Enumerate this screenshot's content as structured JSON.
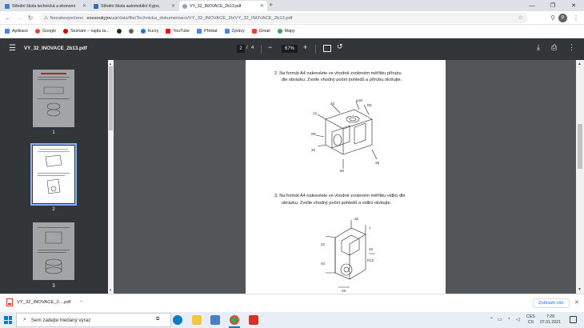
{
  "tabs": [
    {
      "title": "Střední škola technická a ekonomi",
      "favicon_color": "#3b7dd8",
      "active": false
    },
    {
      "title": "Střední škola automobilní Kyjov,",
      "favicon_color": "#2f6fbd",
      "active": false
    },
    {
      "title": "VY_32_INOVACE_2b13.pdf",
      "favicon_color": "#9aa0a6",
      "active": true
    }
  ],
  "address": {
    "security_label": "Nezabezpečeno",
    "url_host": "sossoukyjov.cz",
    "url_path": "/data/file/Technicka_dokumentace/VY_32_INOVACE_2b/VY_32_INOVACE_2b13.pdf",
    "profile_initial": "P"
  },
  "bookmarks": [
    {
      "label": "Aplikace",
      "color": "#4285f4"
    },
    {
      "label": "Google",
      "color": "#ea4335"
    },
    {
      "label": "Seznam – najdu ta...",
      "color": "#cc0000"
    },
    {
      "label": "",
      "color": "#5f6368"
    },
    {
      "label": "Kurzy",
      "color": "#1a73e8"
    },
    {
      "label": "YouTube",
      "color": "#ff0000"
    },
    {
      "label": "Překlat",
      "color": "#4285f4"
    },
    {
      "label": "Zprávy",
      "color": "#4285f4"
    },
    {
      "label": "Gmail",
      "color": "#ea4335"
    },
    {
      "label": "Mapy",
      "color": "#34a853"
    }
  ],
  "pdf": {
    "title": "VY_32_INOVACE_2b13.pdf",
    "current_page": "2",
    "page_sep": "/",
    "total_pages": "4",
    "zoom": "67%"
  },
  "thumbnails": [
    {
      "number": "1",
      "selected": false
    },
    {
      "number": "2",
      "selected": true
    },
    {
      "number": "3",
      "selected": false
    }
  ],
  "page_content": {
    "task2_line1": "2.  Na formát A4 nakreslete ve vhodně zvoleném měřítku přírubu",
    "task2_line2": "dle obrázku. Zvolte vhodný počet pohledů a přírubu okótujte.",
    "task3_line1": "3.  Na formát A4 nakreslete ve vhodně zvoleném měřítku vidlici dle",
    "task3_line2": "obrázku. Zvolte vhodný počet pohledů a vidlici okótujte."
  },
  "download": {
    "filename": "VY_32_INOVACE_2....pdf",
    "show_all": "Zobrazit vše"
  },
  "taskbar": {
    "search_placeholder": "Sem zadejte hledaný výraz",
    "lang1": "CES",
    "lang2": "CS",
    "time": "7:29",
    "date": "07.01.2021"
  }
}
